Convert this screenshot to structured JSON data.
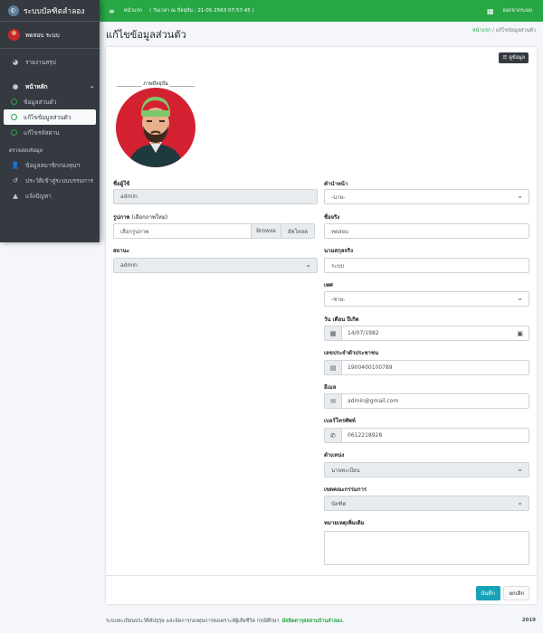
{
  "sidebar": {
    "brand": "ระบบบัลฑิตลำลอง",
    "user": "ทดสอบ ระบบ",
    "items": [
      {
        "label": "รายงานสรุป",
        "icon": "chart-pie-icon"
      },
      {
        "label": "หน้าหลัก",
        "icon": "user-circle-icon"
      },
      {
        "label": "ข้อมูลส่วนตัว",
        "icon": "circle-icon"
      },
      {
        "label": "แก้ไขข้อมูลส่วนตัว",
        "icon": "circle-icon"
      },
      {
        "label": "แก้ไขรหัสผ่าน",
        "icon": "circle-icon"
      }
    ],
    "section_header": "ตรวจสอบข้อมูล",
    "items2": [
      {
        "label": "ข้อมูลสมาชิกกองทุนฯ",
        "icon": "user-edit-icon"
      },
      {
        "label": "ประวัติเข้าสู่ระบบบรรมการ",
        "icon": "history-icon"
      },
      {
        "label": "แจ้งปัญหา",
        "icon": "warning-icon"
      }
    ]
  },
  "topnav": {
    "home": "หน้าแรก",
    "clock": "( วันเวลา ณ ปัจจุบัน : 21-05-2563 07:57:45 )",
    "logout": "ออกจากระบบ"
  },
  "page": {
    "title": "แก้ไขข้อมูลส่วนตัว",
    "breadcrumb_home": "หน้าแรก",
    "breadcrumb_sep": "/",
    "breadcrumb_current": "แก้ไขข้อมูลส่วนตัว",
    "data_button": "ดูข้อมูล"
  },
  "form": {
    "photo_label": "__________ ภาพปัจจุบัน __________",
    "username_label": "ชื่อผู้ใช้",
    "username_value": "admin",
    "image_label": "รูปภาพ",
    "image_sub": "(เลือกภาพใหม่)",
    "file_placeholder": "เลือกรูปภาพ",
    "browse": "Browse",
    "upload": "อัพโหลด",
    "status_label": "สถานะ",
    "status_value": "admin",
    "prefix_label": "คำนำหน้า",
    "prefix_value": "-นาย-",
    "firstname_label": "ชื่อจริง",
    "firstname_value": "ทดสอบ",
    "lastname_label": "นามสกุลจริง",
    "lastname_value": "ระบบ",
    "gender_label": "เพศ",
    "gender_value": "-ชาย-",
    "dob_label": "วัน เดือน ปีเกิด",
    "dob_value": "14/07/1982",
    "idcard_label": "เลขประจำตัวประชาชน",
    "idcard_value": "1900400100789",
    "email_label": "อีเมล",
    "email_value": "admin@gmail.com",
    "phone_label": "เบอร์โทรศัพท์",
    "phone_value": "0612218928",
    "position_label": "ตำแหน่ง",
    "position_value": "นายทะเบียน",
    "committee_label": "เขตคณะกรรมการ",
    "committee_value": "บัลฑิต",
    "note_label": "หมายเหตุเพิ่มเติม",
    "save": "บันทึก",
    "cancel": "ยกเลิก"
  },
  "footer": {
    "text": "ระบบทะเบียนประวัติสัปปุรุษ และจัดการกองทุนการสงเคราะห์ผู้เสียชีวิต กรณีศึกษา",
    "link": "มัสยิดดารุสสลามบ้านลำลอง.",
    "year": "2019"
  },
  "colors": {
    "accent": "#28a745",
    "sidebar": "#343a40",
    "info": "#17a2b8",
    "avatar_bg": "#d32131"
  }
}
